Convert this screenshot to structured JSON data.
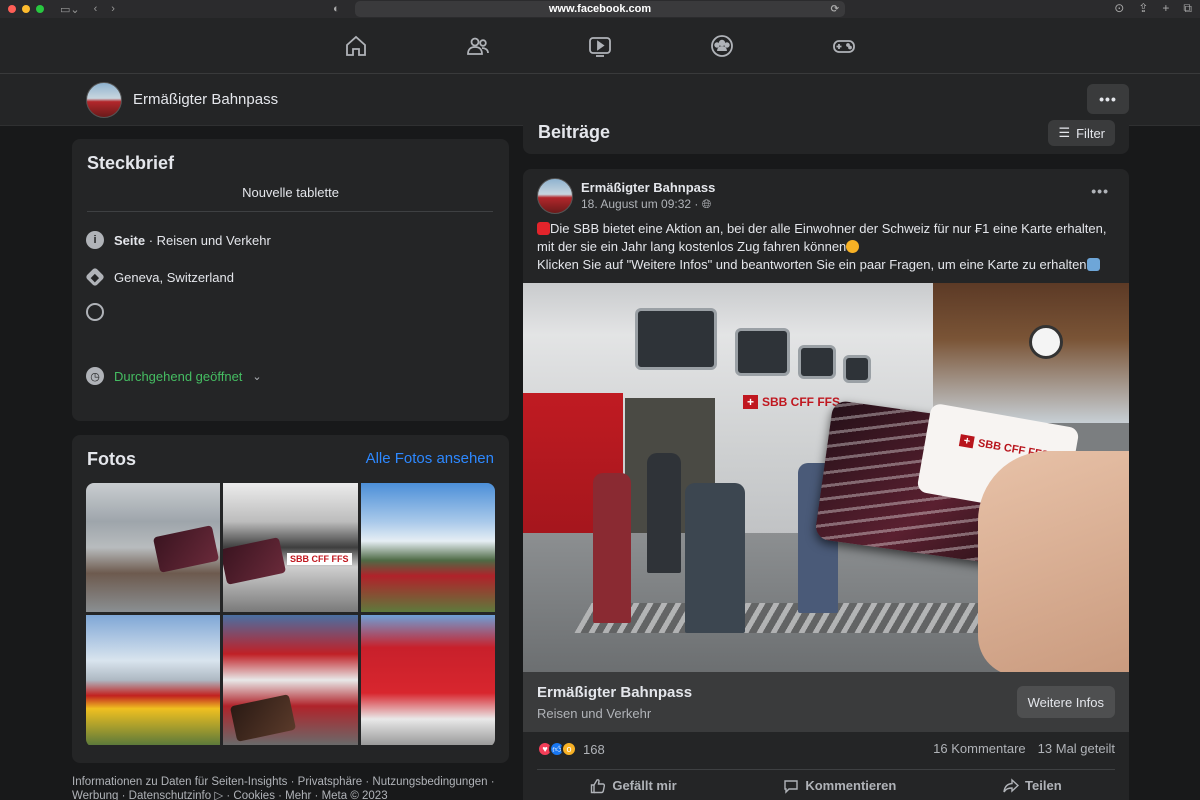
{
  "browser": {
    "url": "www.facebook.com",
    "traffic_colors": [
      "#ff5f57",
      "#febc2e",
      "#28c840"
    ]
  },
  "nav": {
    "icons": [
      "home-icon",
      "friends-icon",
      "watch-icon",
      "groups-icon",
      "gaming-icon"
    ]
  },
  "page": {
    "name": "Ermäßigter Bahnpass",
    "more_label": "•••"
  },
  "steckbrief": {
    "title": "Steckbrief",
    "bio": "Nouvelle tablette",
    "category_prefix": "Seite",
    "category": " · Reisen und Verkehr",
    "location": "Geneva, Switzerland",
    "hours": "Durchgehend geöffnet"
  },
  "fotos": {
    "title": "Fotos",
    "see_all": "Alle Fotos ansehen"
  },
  "footer": {
    "line1": "Informationen zu Daten für Seiten-Insights · Privatsphäre · Nutzungsbedingungen ·",
    "line2": "Werbung · Datenschutzinfo ▷ · Cookies · Mehr · Meta © 2023"
  },
  "posts_header": {
    "title": "Beiträge",
    "filter_label": "Filter"
  },
  "post": {
    "author": "Ermäßigter Bahnpass",
    "time": "18. August um 09:32 · ",
    "line1": "Die SBB bietet eine Aktion an, bei der alle Einwohner der Schweiz für nur ₣1 eine Karte erhalten,",
    "line2": "mit der sie ein Jahr lang kostenlos Zug fahren können",
    "line3": "Klicken Sie auf \"Weitere Infos\" und beantworten Sie ein paar Fragen, um eine Karte zu erhalten",
    "photo_sign": "SBB CFF FFS",
    "link_title": "Ermäßigter Bahnpass",
    "link_subtitle": "Reisen und Verkehr",
    "link_button": "Weitere Infos",
    "reaction_count": "168",
    "comments": "16 Kommentare",
    "shares": "13 Mal geteilt",
    "like_label": "Gefällt mir",
    "comment_label": "Kommentieren",
    "share_label": "Teilen"
  }
}
